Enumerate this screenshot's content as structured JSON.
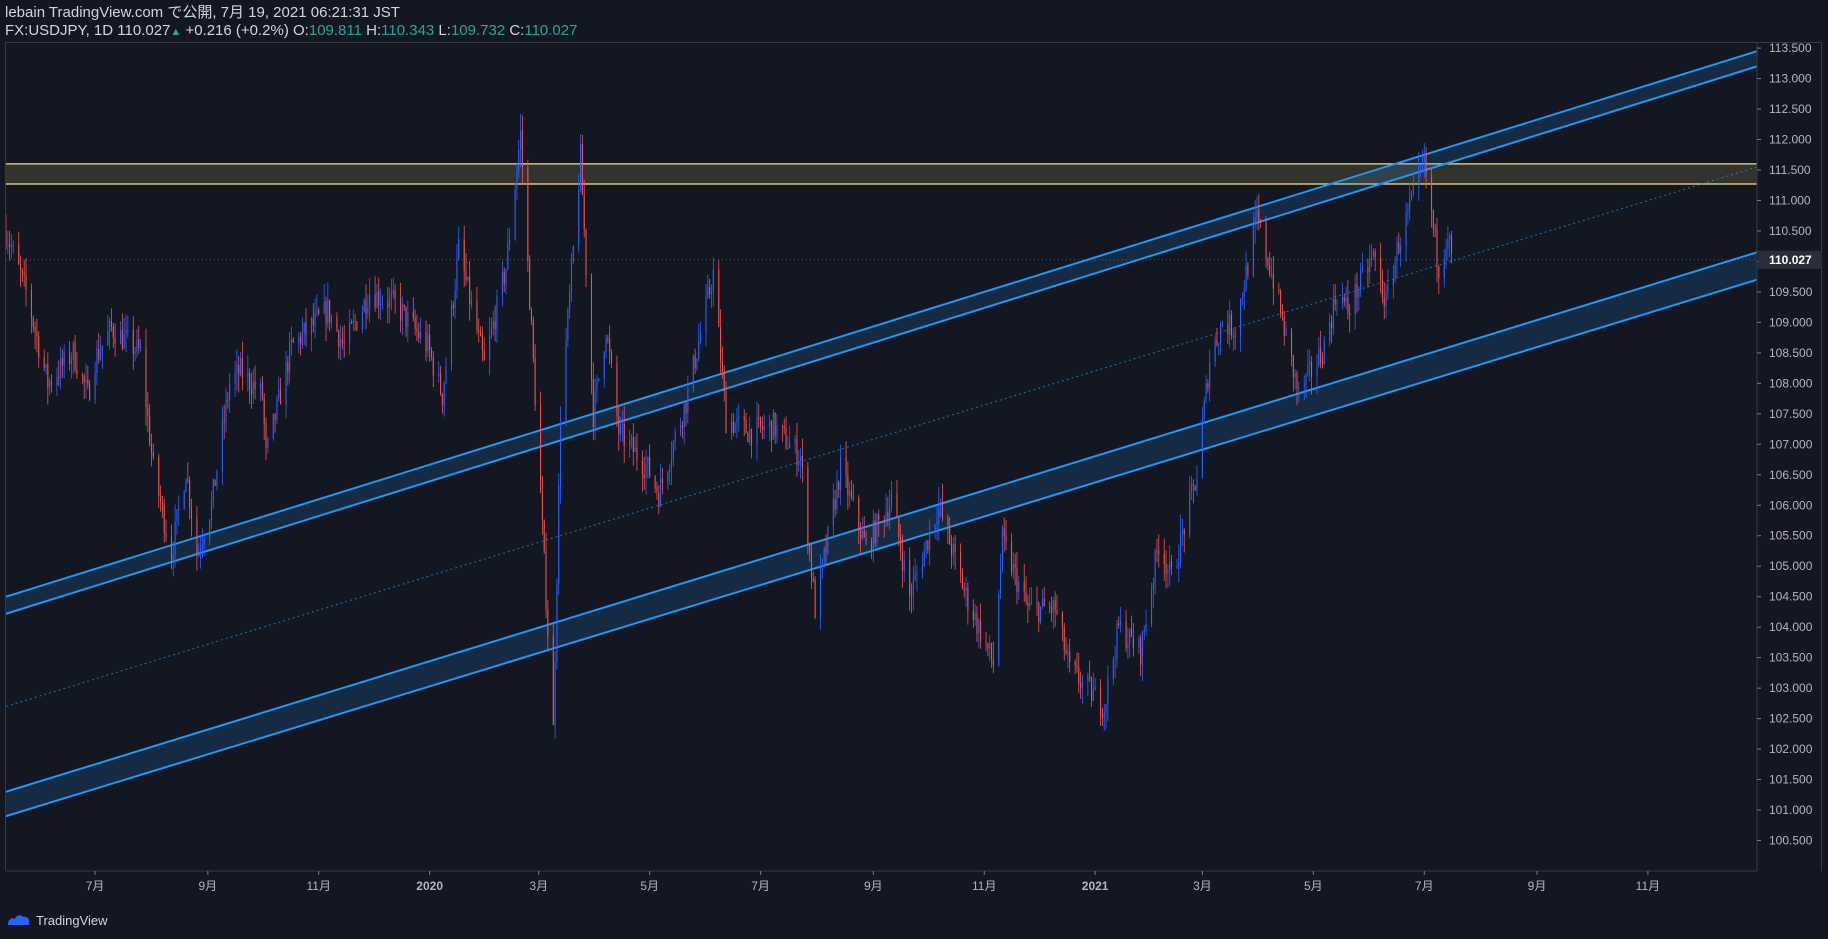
{
  "header": {
    "line1": "lebain TradingView.com で公開, 7月 19, 2021 06:21:31 JST",
    "symbol": "FX:USDJPY, 1D",
    "last": "110.027",
    "change": "+0.216 (+0.2%)",
    "o_label": "O:",
    "o": "109.811",
    "h_label": "H:",
    "h": "110.343",
    "l_label": "L:",
    "l": "109.732",
    "c_label": "C:",
    "c": "110.027"
  },
  "footer": {
    "brand": "TradingView",
    "logo_icon": "tradingview-logo-icon"
  },
  "colors": {
    "bg": "#131722",
    "up": "#2962ff",
    "down": "#ef5350",
    "channel": "#2196f3",
    "zone": "#f7e479",
    "axis": "#b2b5be"
  },
  "chart_data": {
    "type": "candlestick",
    "symbol": "FX:USDJPY",
    "interval": "1D",
    "yaxis": {
      "min": 100.0,
      "max": 113.6,
      "ticks": [
        100.5,
        101.0,
        101.5,
        102.0,
        102.5,
        103.0,
        103.5,
        104.0,
        104.5,
        105.0,
        105.5,
        106.0,
        106.5,
        107.0,
        107.5,
        108.0,
        108.5,
        109.0,
        109.5,
        110.0,
        110.5,
        111.0,
        111.5,
        112.0,
        112.5,
        113.0,
        113.5
      ],
      "tick_format": 3,
      "current_price": 110.027
    },
    "xaxis": {
      "start": "2019-05-13",
      "end": "2021-12-31",
      "ticks": [
        {
          "date": "2019-07-01",
          "label": "7月"
        },
        {
          "date": "2019-09-01",
          "label": "9月"
        },
        {
          "date": "2019-11-01",
          "label": "11月"
        },
        {
          "date": "2020-01-01",
          "label": "2020"
        },
        {
          "date": "2020-03-01",
          "label": "3月"
        },
        {
          "date": "2020-05-01",
          "label": "5月"
        },
        {
          "date": "2020-07-01",
          "label": "7月"
        },
        {
          "date": "2020-09-01",
          "label": "9月"
        },
        {
          "date": "2020-11-01",
          "label": "11月"
        },
        {
          "date": "2021-01-01",
          "label": "2021"
        },
        {
          "date": "2021-03-01",
          "label": "3月"
        },
        {
          "date": "2021-05-01",
          "label": "5月"
        },
        {
          "date": "2021-07-01",
          "label": "7月"
        },
        {
          "date": "2021-09-01",
          "label": "9月"
        },
        {
          "date": "2021-11-01",
          "label": "11月"
        }
      ]
    },
    "price_path": [
      [
        "2019-05-13",
        110.5
      ],
      [
        "2019-05-24",
        109.5
      ],
      [
        "2019-06-05",
        108.0
      ],
      [
        "2019-06-19",
        108.5
      ],
      [
        "2019-06-27",
        107.8
      ],
      [
        "2019-07-01",
        108.4
      ],
      [
        "2019-07-10",
        108.9
      ],
      [
        "2019-07-26",
        108.5
      ],
      [
        "2019-08-02",
        106.6
      ],
      [
        "2019-08-12",
        105.2
      ],
      [
        "2019-08-20",
        106.6
      ],
      [
        "2019-08-26",
        105.2
      ],
      [
        "2019-09-03",
        106.0
      ],
      [
        "2019-09-13",
        108.0
      ],
      [
        "2019-09-19",
        108.2
      ],
      [
        "2019-10-01",
        107.8
      ],
      [
        "2019-10-03",
        106.8
      ],
      [
        "2019-10-17",
        108.6
      ],
      [
        "2019-11-06",
        109.2
      ],
      [
        "2019-11-15",
        108.6
      ],
      [
        "2019-11-29",
        109.5
      ],
      [
        "2019-12-13",
        109.3
      ],
      [
        "2019-12-31",
        108.6
      ],
      [
        "2020-01-08",
        107.8
      ],
      [
        "2020-01-17",
        110.2
      ],
      [
        "2020-01-31",
        108.3
      ],
      [
        "2020-02-12",
        109.9
      ],
      [
        "2020-02-20",
        112.1
      ],
      [
        "2020-02-28",
        107.8
      ],
      [
        "2020-03-09",
        102.3
      ],
      [
        "2020-03-13",
        107.5
      ],
      [
        "2020-03-24",
        111.7
      ],
      [
        "2020-03-31",
        107.5
      ],
      [
        "2020-04-07",
        108.9
      ],
      [
        "2020-04-14",
        107.2
      ],
      [
        "2020-04-30",
        106.6
      ],
      [
        "2020-05-06",
        106.2
      ],
      [
        "2020-05-21",
        107.7
      ],
      [
        "2020-06-05",
        109.8
      ],
      [
        "2020-06-12",
        107.4
      ],
      [
        "2020-06-26",
        107.2
      ],
      [
        "2020-07-08",
        107.3
      ],
      [
        "2020-07-23",
        106.8
      ],
      [
        "2020-07-31",
        104.3
      ],
      [
        "2020-08-14",
        106.6
      ],
      [
        "2020-08-28",
        105.3
      ],
      [
        "2020-09-11",
        106.1
      ],
      [
        "2020-09-21",
        104.5
      ],
      [
        "2020-10-07",
        106.0
      ],
      [
        "2020-10-21",
        104.6
      ],
      [
        "2020-11-06",
        103.4
      ],
      [
        "2020-11-11",
        105.4
      ],
      [
        "2020-11-25",
        104.3
      ],
      [
        "2020-12-10",
        104.3
      ],
      [
        "2020-12-18",
        103.3
      ],
      [
        "2021-01-06",
        102.7
      ],
      [
        "2021-01-14",
        104.0
      ],
      [
        "2021-01-26",
        103.6
      ],
      [
        "2021-02-05",
        105.4
      ],
      [
        "2021-02-12",
        104.8
      ],
      [
        "2021-02-26",
        106.5
      ],
      [
        "2021-03-05",
        108.4
      ],
      [
        "2021-03-12",
        109.0
      ],
      [
        "2021-03-19",
        108.9
      ],
      [
        "2021-03-31",
        110.7
      ],
      [
        "2021-04-09",
        109.7
      ],
      [
        "2021-04-23",
        107.8
      ],
      [
        "2021-05-07",
        108.6
      ],
      [
        "2021-05-14",
        109.5
      ],
      [
        "2021-05-20",
        109.2
      ],
      [
        "2021-06-03",
        110.1
      ],
      [
        "2021-06-10",
        109.3
      ],
      [
        "2021-06-17",
        110.3
      ],
      [
        "2021-07-01",
        111.6
      ],
      [
        "2021-07-09",
        109.9
      ],
      [
        "2021-07-14",
        110.5
      ],
      [
        "2021-07-16",
        110.03
      ]
    ],
    "zone": {
      "top": 111.6,
      "bottom": 111.27,
      "from": "2019-05-13",
      "to": "2021-12-31"
    },
    "channels": [
      {
        "name": "upper",
        "lines": [
          [
            [
              "2019-05-13",
              104.5
            ],
            [
              "2021-12-31",
              113.45
            ]
          ],
          [
            [
              "2019-05-13",
              104.22
            ],
            [
              "2021-12-31",
              113.2
            ]
          ]
        ]
      },
      {
        "name": "lower",
        "lines": [
          [
            [
              "2019-05-13",
              101.3
            ],
            [
              "2021-12-31",
              110.15
            ]
          ],
          [
            [
              "2019-05-13",
              100.9
            ],
            [
              "2021-12-31",
              109.7
            ]
          ]
        ]
      }
    ],
    "midline": [
      [
        "2019-05-13",
        102.7
      ],
      [
        "2021-12-31",
        111.55
      ]
    ],
    "grid": false,
    "legend": "none"
  }
}
